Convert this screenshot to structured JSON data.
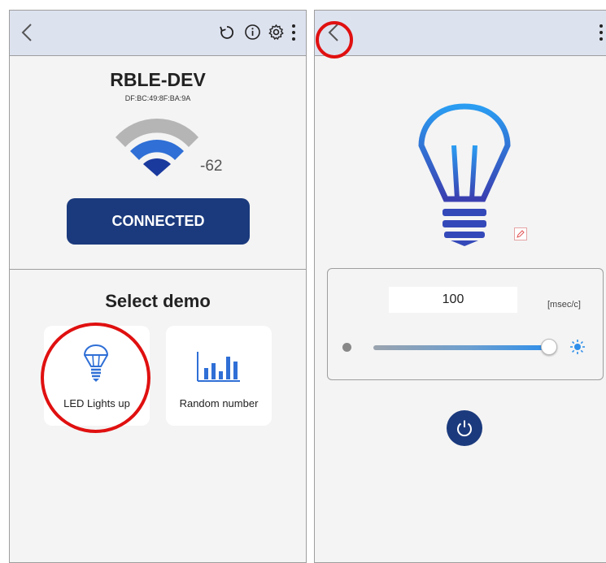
{
  "left_screen": {
    "device": {
      "name": "RBLE-DEV",
      "address": "DF:BC:49:8F:BA:9A",
      "rssi": "-62",
      "status_button": "CONNECTED"
    },
    "demo_section": {
      "title": "Select demo",
      "items": [
        {
          "label": "LED Lights up",
          "icon": "light-bulb-icon"
        },
        {
          "label": "Random number",
          "icon": "bar-chart-icon"
        }
      ]
    }
  },
  "right_screen": {
    "interval_value": "100",
    "interval_unit": "[msec/c]",
    "brightness_level": 1.0
  },
  "colors": {
    "appbar": "#dde2ef",
    "accent_dark": "#1b3a7d",
    "signal_blue": "#2f6fd6",
    "annotation_red": "#e01010"
  }
}
